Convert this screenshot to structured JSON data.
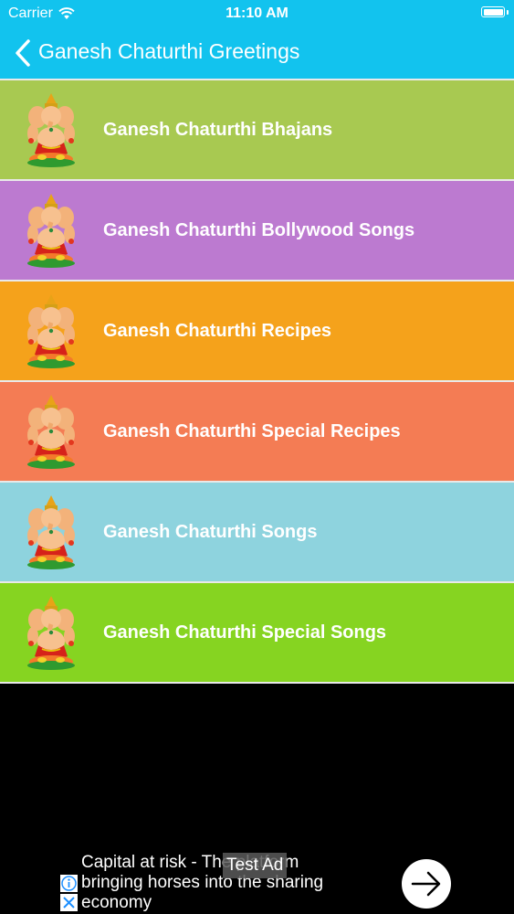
{
  "status_bar": {
    "carrier": "Carrier",
    "time": "11:10 AM"
  },
  "nav": {
    "title": "Ganesh Chaturthi Greetings",
    "back_icon": "chevron-left-icon"
  },
  "colors": {
    "nav_background": "#12c3ee",
    "screen_background": "#000000"
  },
  "menu": {
    "items": [
      {
        "label": "Ganesh Chaturthi Bhajans",
        "color": "#a8c951"
      },
      {
        "label": "Ganesh Chaturthi Bollywood Songs",
        "color": "#bc7ad0"
      },
      {
        "label": "Ganesh Chaturthi Recipes",
        "color": "#f5a21b"
      },
      {
        "label": "Ganesh Chaturthi Special Recipes",
        "color": "#f47c54"
      },
      {
        "label": "Ganesh Chaturthi Songs",
        "color": "#8ed3de"
      },
      {
        "label": "Ganesh Chaturthi Special Songs",
        "color": "#86d421"
      }
    ],
    "item_icon": "ganesha-icon"
  },
  "ad": {
    "text": "Capital at risk - The platform bringing horses into the sharing economy",
    "badge": "Test Ad",
    "info_icon": "info-icon",
    "close_icon": "close-icon",
    "arrow_icon": "arrow-right-icon"
  }
}
